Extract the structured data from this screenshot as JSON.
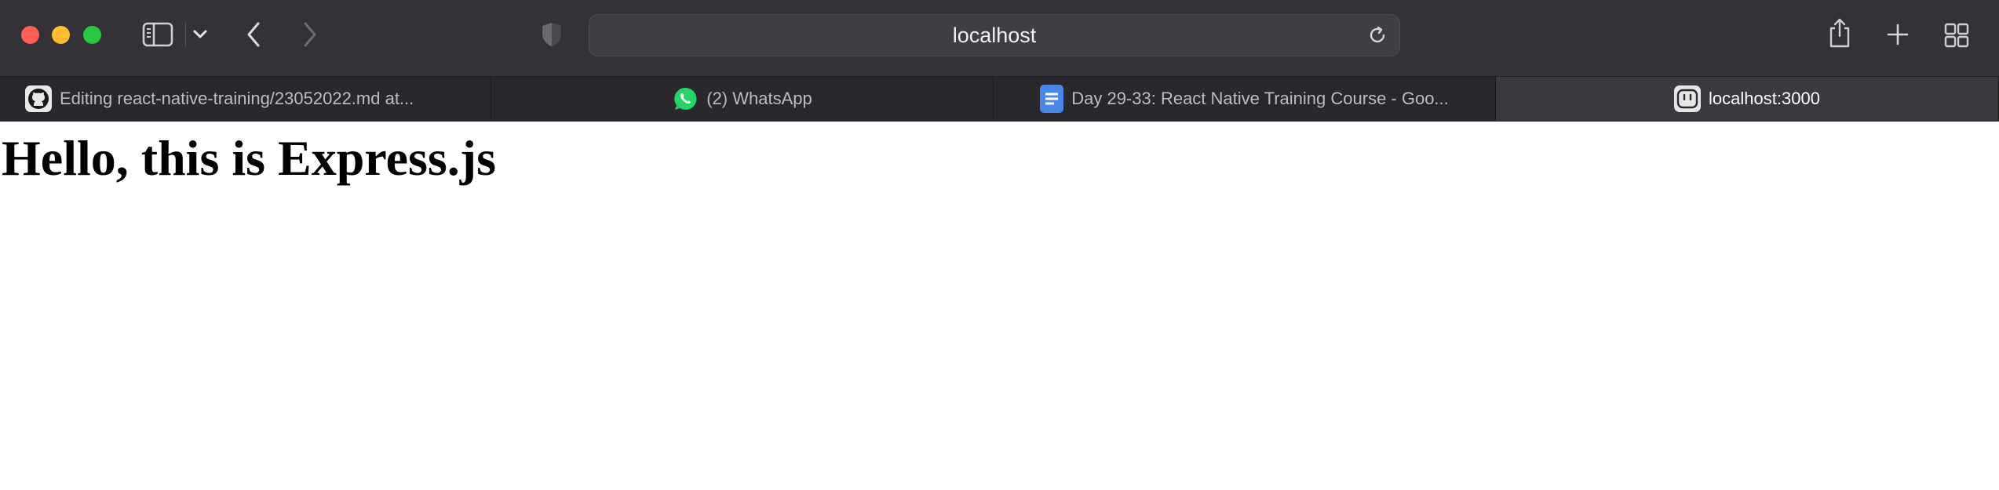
{
  "window": {
    "controls": [
      "close",
      "minimize",
      "zoom"
    ]
  },
  "toolbar": {
    "address": "localhost",
    "icons": [
      "sidebar-icon",
      "chevron-down-icon",
      "back-icon",
      "forward-icon",
      "privacy-shield-icon",
      "reload-icon",
      "share-icon",
      "new-tab-icon",
      "tab-overview-icon"
    ]
  },
  "tabs": [
    {
      "label": "Editing react-native-training/23052022.md at...",
      "icon": "github-icon",
      "active": false
    },
    {
      "label": "(2) WhatsApp",
      "icon": "whatsapp-icon",
      "active": false
    },
    {
      "label": "Day 29-33: React Native Training Course - Goo...",
      "icon": "google-docs-icon",
      "active": false
    },
    {
      "label": "localhost:3000",
      "icon": "localhost-icon",
      "active": true
    }
  ],
  "page": {
    "heading": "Hello, this is Express.js"
  },
  "colors": {
    "toolbar_bg": "#343237",
    "tabbar_bg": "#29282c",
    "active_tab_bg": "#3b393e",
    "close": "#fe5f57",
    "minimize": "#febc2e",
    "zoom": "#28c840",
    "whatsapp": "#25d366",
    "google_docs": "#4a86e8"
  }
}
